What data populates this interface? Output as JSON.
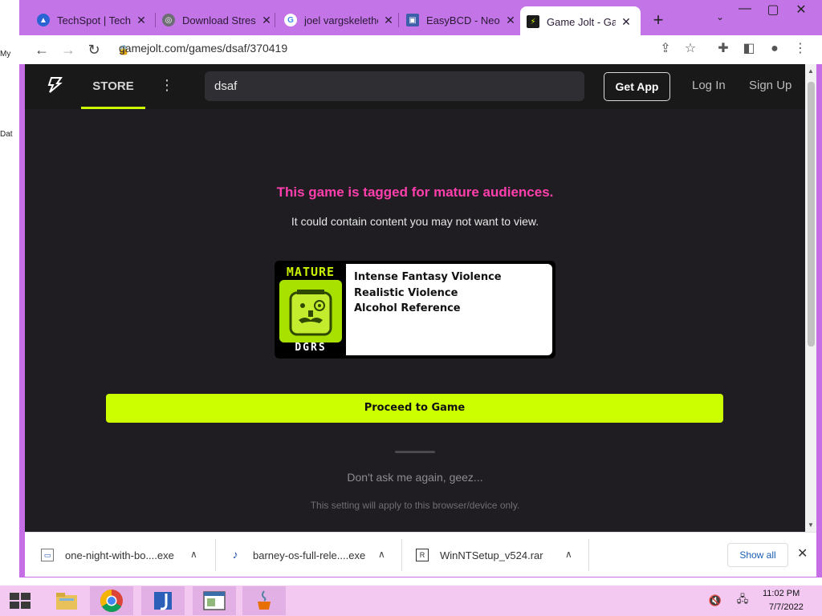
{
  "browser": {
    "tabs": [
      {
        "title": "TechSpot | Tech",
        "icon": "techspot-icon"
      },
      {
        "title": "Download Stress",
        "icon": "globe-icon"
      },
      {
        "title": "joel vargskeletho",
        "icon": "google-icon"
      },
      {
        "title": "EasyBCD - NeoSm",
        "icon": "easybcd-icon"
      },
      {
        "title": "Game Jolt - Game",
        "icon": "gamejolt-icon"
      }
    ],
    "url": "gamejolt.com/games/dsaf/370419"
  },
  "gamejolt": {
    "store_label": "STORE",
    "search_value": "dsaf",
    "get_app_label": "Get App",
    "login_label": "Log In",
    "signup_label": "Sign Up",
    "warning_title": "This game is tagged for mature audiences.",
    "warning_subtitle": "It could contain content you may not want to view.",
    "rating": {
      "badge_top": "MATURE",
      "badge_bottom": "DGRS",
      "descriptors": [
        "Intense Fantasy Violence",
        "Realistic Violence",
        "Alcohol Reference"
      ]
    },
    "proceed_label": "Proceed to Game",
    "dont_ask_label": "Don't ask me again, geez...",
    "setting_note": "This setting will apply to this browser/device only."
  },
  "downloads": {
    "items": [
      {
        "name": "one-night-with-bo....exe"
      },
      {
        "name": "barney-os-full-rele....exe"
      },
      {
        "name": "WinNTSetup_v524.rar"
      }
    ],
    "show_all_label": "Show all"
  },
  "taskbar": {
    "time": "11:02 PM",
    "date": "7/7/2022"
  },
  "desktop": {
    "icon_labels": [
      "My",
      "Dat"
    ]
  },
  "colors": {
    "accent": "#ccff00",
    "warning": "#ff3fac",
    "browser_frame": "#c374e7"
  }
}
